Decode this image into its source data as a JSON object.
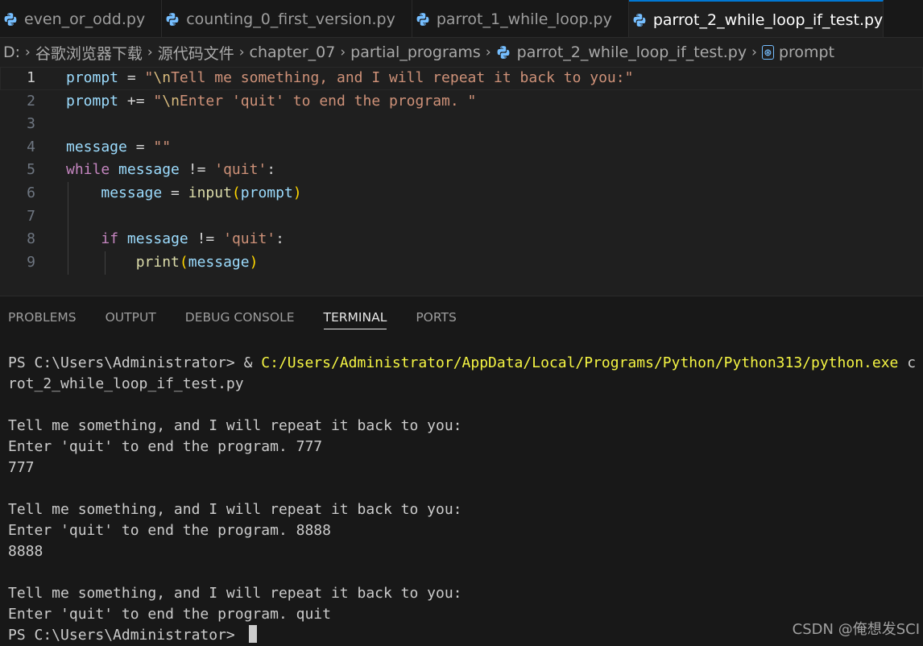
{
  "tabs": [
    {
      "label": "even_or_odd.py",
      "active": false
    },
    {
      "label": "counting_0_first_version.py",
      "active": false
    },
    {
      "label": "parrot_1_while_loop.py",
      "active": false
    },
    {
      "label": "parrot_2_while_loop_if_test.py",
      "active": true
    }
  ],
  "breadcrumb": {
    "items": [
      "D:",
      "谷歌浏览器下载",
      "源代码文件",
      "chapter_07",
      "partial_programs",
      "parrot_2_while_loop_if_test.py",
      "prompt"
    ]
  },
  "editor": {
    "line_numbers": [
      "1",
      "2",
      "3",
      "4",
      "5",
      "6",
      "7",
      "8",
      "9"
    ],
    "current_line": 1,
    "lines": [
      [
        {
          "t": "prompt",
          "c": "var"
        },
        {
          "t": " = ",
          "c": "op"
        },
        {
          "t": "\"",
          "c": "str"
        },
        {
          "t": "\\n",
          "c": "esc"
        },
        {
          "t": "Tell me something, and I will repeat it back to you:\"",
          "c": "str"
        }
      ],
      [
        {
          "t": "prompt",
          "c": "var"
        },
        {
          "t": " += ",
          "c": "op"
        },
        {
          "t": "\"",
          "c": "str"
        },
        {
          "t": "\\n",
          "c": "esc"
        },
        {
          "t": "Enter 'quit' to end the program. \"",
          "c": "str"
        }
      ],
      [],
      [
        {
          "t": "message",
          "c": "var"
        },
        {
          "t": " = ",
          "c": "op"
        },
        {
          "t": "\"\"",
          "c": "str"
        }
      ],
      [
        {
          "t": "while",
          "c": "kw"
        },
        {
          "t": " ",
          "c": "op"
        },
        {
          "t": "message",
          "c": "var"
        },
        {
          "t": " != ",
          "c": "op"
        },
        {
          "t": "'quit'",
          "c": "str"
        },
        {
          "t": ":",
          "c": "op"
        }
      ],
      [
        {
          "t": "    ",
          "c": "op"
        },
        {
          "t": "message",
          "c": "var"
        },
        {
          "t": " = ",
          "c": "op"
        },
        {
          "t": "input",
          "c": "fn"
        },
        {
          "t": "(",
          "c": "par1"
        },
        {
          "t": "prompt",
          "c": "var"
        },
        {
          "t": ")",
          "c": "par1"
        }
      ],
      [],
      [
        {
          "t": "    ",
          "c": "op"
        },
        {
          "t": "if",
          "c": "kw"
        },
        {
          "t": " ",
          "c": "op"
        },
        {
          "t": "message",
          "c": "var"
        },
        {
          "t": " != ",
          "c": "op"
        },
        {
          "t": "'quit'",
          "c": "str"
        },
        {
          "t": ":",
          "c": "op"
        }
      ],
      [
        {
          "t": "        ",
          "c": "op"
        },
        {
          "t": "print",
          "c": "fn"
        },
        {
          "t": "(",
          "c": "par1"
        },
        {
          "t": "message",
          "c": "var"
        },
        {
          "t": ")",
          "c": "par1"
        }
      ]
    ]
  },
  "panel": {
    "tabs": [
      "PROBLEMS",
      "OUTPUT",
      "DEBUG CONSOLE",
      "TERMINAL",
      "PORTS"
    ],
    "active_tab": "TERMINAL"
  },
  "terminal": {
    "lines": [
      [
        {
          "t": "PS C:\\Users\\Administrator> & ",
          "c": ""
        },
        {
          "t": "C:/Users/Administrator/AppData/Local/Programs/Python/Python313/python.exe",
          "c": "yellow"
        },
        {
          "t": " c",
          "c": ""
        }
      ],
      [
        {
          "t": "rot_2_while_loop_if_test.py",
          "c": ""
        }
      ],
      [],
      [
        {
          "t": "Tell me something, and I will repeat it back to you:",
          "c": ""
        }
      ],
      [
        {
          "t": "Enter 'quit' to end the program. 777",
          "c": ""
        }
      ],
      [
        {
          "t": "777",
          "c": ""
        }
      ],
      [],
      [
        {
          "t": "Tell me something, and I will repeat it back to you:",
          "c": ""
        }
      ],
      [
        {
          "t": "Enter 'quit' to end the program. 8888",
          "c": ""
        }
      ],
      [
        {
          "t": "8888",
          "c": ""
        }
      ],
      [],
      [
        {
          "t": "Tell me something, and I will repeat it back to you:",
          "c": ""
        }
      ],
      [
        {
          "t": "Enter 'quit' to end the program. quit",
          "c": ""
        }
      ],
      [
        {
          "t": "PS C:\\Users\\Administrator> ",
          "c": ""
        }
      ]
    ]
  },
  "watermark": "CSDN @俺想发SCI",
  "colors": {
    "accent": "#0078d4",
    "keyword": "#c586c0",
    "variable": "#9cdcfe",
    "string": "#ce9178",
    "function": "#dcdcaa",
    "terminal_yellow": "#f5f543"
  }
}
